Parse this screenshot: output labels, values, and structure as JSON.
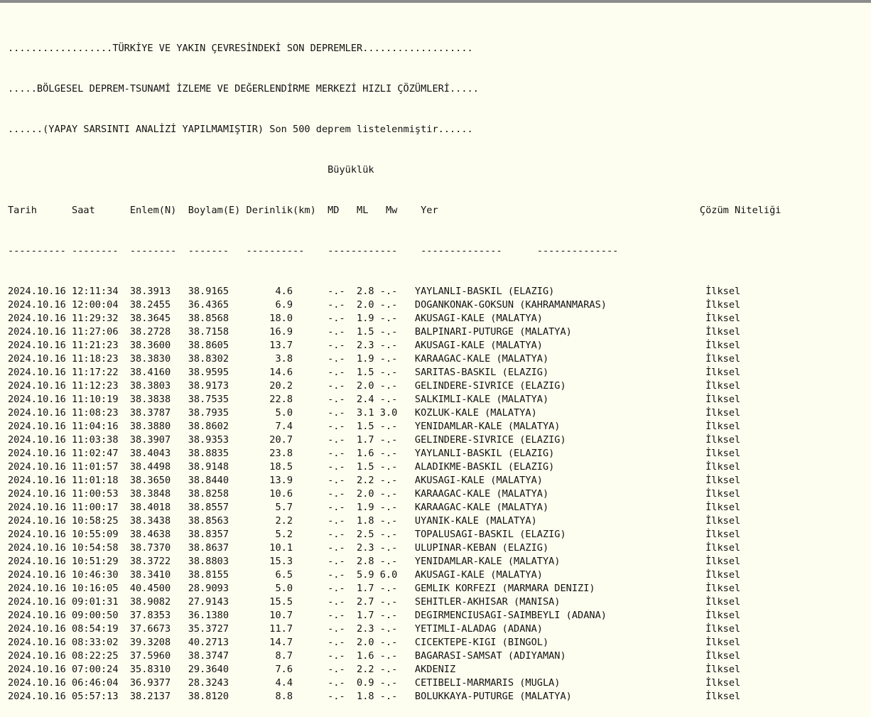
{
  "header": {
    "line1": "..................TÜRKİYE VE YAKIN ÇEVRESİNDEKİ SON DEPREMLER...................",
    "line2": ".....BÖLGESEL DEPREM-TSUNAMİ İZLEME VE DEĞERLENDİRME MERKEZİ HIZLI ÇÖZÜMLERİ.....",
    "line3": "......(YAPAY SARSINTI ANALİZİ YAPILMAMIŞTIR) Son 500 deprem listelenmiştir......"
  },
  "columns": {
    "magnitude_group": "Büyüklük",
    "tarih": "Tarih",
    "saat": "Saat",
    "enlem": "Enlem(N)",
    "boylam": "Boylam(E)",
    "derinlik": "Derinlik(km)",
    "md": "MD",
    "ml": "ML",
    "mw": "Mw",
    "yer": "Yer",
    "cozum": "Çözüm Niteliği"
  },
  "rows": [
    {
      "date": "2024.10.16",
      "time": "12:11:34",
      "lat": "38.3913",
      "lon": "38.9165",
      "depth": "4.6",
      "md": "-.-",
      "ml": "2.8",
      "mw": "-.-",
      "place": "YAYLANLI-BASKIL (ELAZIG)",
      "sol": "İlksel"
    },
    {
      "date": "2024.10.16",
      "time": "12:00:04",
      "lat": "38.2455",
      "lon": "36.4365",
      "depth": "6.9",
      "md": "-.-",
      "ml": "2.0",
      "mw": "-.-",
      "place": "DOGANKONAK-GOKSUN (KAHRAMANMARAS)",
      "sol": "İlksel"
    },
    {
      "date": "2024.10.16",
      "time": "11:29:32",
      "lat": "38.3645",
      "lon": "38.8568",
      "depth": "18.0",
      "md": "-.-",
      "ml": "1.9",
      "mw": "-.-",
      "place": "AKUSAGI-KALE (MALATYA)",
      "sol": "İlksel"
    },
    {
      "date": "2024.10.16",
      "time": "11:27:06",
      "lat": "38.2728",
      "lon": "38.7158",
      "depth": "16.9",
      "md": "-.-",
      "ml": "1.5",
      "mw": "-.-",
      "place": "BALPINARI-PUTURGE (MALATYA)",
      "sol": "İlksel"
    },
    {
      "date": "2024.10.16",
      "time": "11:21:23",
      "lat": "38.3600",
      "lon": "38.8605",
      "depth": "13.7",
      "md": "-.-",
      "ml": "2.3",
      "mw": "-.-",
      "place": "AKUSAGI-KALE (MALATYA)",
      "sol": "İlksel"
    },
    {
      "date": "2024.10.16",
      "time": "11:18:23",
      "lat": "38.3830",
      "lon": "38.8302",
      "depth": "3.8",
      "md": "-.-",
      "ml": "1.9",
      "mw": "-.-",
      "place": "KARAAGAC-KALE (MALATYA)",
      "sol": "İlksel"
    },
    {
      "date": "2024.10.16",
      "time": "11:17:22",
      "lat": "38.4160",
      "lon": "38.9595",
      "depth": "14.6",
      "md": "-.-",
      "ml": "1.5",
      "mw": "-.-",
      "place": "SARITAS-BASKIL (ELAZIG)",
      "sol": "İlksel"
    },
    {
      "date": "2024.10.16",
      "time": "11:12:23",
      "lat": "38.3803",
      "lon": "38.9173",
      "depth": "20.2",
      "md": "-.-",
      "ml": "2.0",
      "mw": "-.-",
      "place": "GELINDERE-SIVRICE (ELAZIG)",
      "sol": "İlksel"
    },
    {
      "date": "2024.10.16",
      "time": "11:10:19",
      "lat": "38.3838",
      "lon": "38.7535",
      "depth": "22.8",
      "md": "-.-",
      "ml": "2.4",
      "mw": "-.-",
      "place": "SALKIMLI-KALE (MALATYA)",
      "sol": "İlksel"
    },
    {
      "date": "2024.10.16",
      "time": "11:08:23",
      "lat": "38.3787",
      "lon": "38.7935",
      "depth": "5.0",
      "md": "-.-",
      "ml": "3.1",
      "mw": "3.0",
      "place": "KOZLUK-KALE (MALATYA)",
      "sol": "İlksel"
    },
    {
      "date": "2024.10.16",
      "time": "11:04:16",
      "lat": "38.3880",
      "lon": "38.8602",
      "depth": "7.4",
      "md": "-.-",
      "ml": "1.5",
      "mw": "-.-",
      "place": "YENIDAMLAR-KALE (MALATYA)",
      "sol": "İlksel"
    },
    {
      "date": "2024.10.16",
      "time": "11:03:38",
      "lat": "38.3907",
      "lon": "38.9353",
      "depth": "20.7",
      "md": "-.-",
      "ml": "1.7",
      "mw": "-.-",
      "place": "GELINDERE-SIVRICE (ELAZIG)",
      "sol": "İlksel"
    },
    {
      "date": "2024.10.16",
      "time": "11:02:47",
      "lat": "38.4043",
      "lon": "38.8835",
      "depth": "23.8",
      "md": "-.-",
      "ml": "1.6",
      "mw": "-.-",
      "place": "YAYLANLI-BASKIL (ELAZIG)",
      "sol": "İlksel"
    },
    {
      "date": "2024.10.16",
      "time": "11:01:57",
      "lat": "38.4498",
      "lon": "38.9148",
      "depth": "18.5",
      "md": "-.-",
      "ml": "1.5",
      "mw": "-.-",
      "place": "ALADIKME-BASKIL (ELAZIG)",
      "sol": "İlksel"
    },
    {
      "date": "2024.10.16",
      "time": "11:01:18",
      "lat": "38.3650",
      "lon": "38.8440",
      "depth": "13.9",
      "md": "-.-",
      "ml": "2.2",
      "mw": "-.-",
      "place": "AKUSAGI-KALE (MALATYA)",
      "sol": "İlksel"
    },
    {
      "date": "2024.10.16",
      "time": "11:00:53",
      "lat": "38.3848",
      "lon": "38.8258",
      "depth": "10.6",
      "md": "-.-",
      "ml": "2.0",
      "mw": "-.-",
      "place": "KARAAGAC-KALE (MALATYA)",
      "sol": "İlksel"
    },
    {
      "date": "2024.10.16",
      "time": "11:00:17",
      "lat": "38.4018",
      "lon": "38.8557",
      "depth": "5.7",
      "md": "-.-",
      "ml": "1.9",
      "mw": "-.-",
      "place": "KARAAGAC-KALE (MALATYA)",
      "sol": "İlksel"
    },
    {
      "date": "2024.10.16",
      "time": "10:58:25",
      "lat": "38.3438",
      "lon": "38.8563",
      "depth": "2.2",
      "md": "-.-",
      "ml": "1.8",
      "mw": "-.-",
      "place": "UYANIK-KALE (MALATYA)",
      "sol": "İlksel"
    },
    {
      "date": "2024.10.16",
      "time": "10:55:09",
      "lat": "38.4638",
      "lon": "38.8357",
      "depth": "5.2",
      "md": "-.-",
      "ml": "2.5",
      "mw": "-.-",
      "place": "TOPALUSAGI-BASKIL (ELAZIG)",
      "sol": "İlksel"
    },
    {
      "date": "2024.10.16",
      "time": "10:54:58",
      "lat": "38.7370",
      "lon": "38.8637",
      "depth": "10.1",
      "md": "-.-",
      "ml": "2.3",
      "mw": "-.-",
      "place": "ULUPINAR-KEBAN (ELAZIG)",
      "sol": "İlksel"
    },
    {
      "date": "2024.10.16",
      "time": "10:51:29",
      "lat": "38.3722",
      "lon": "38.8803",
      "depth": "15.3",
      "md": "-.-",
      "ml": "2.8",
      "mw": "-.-",
      "place": "YENIDAMLAR-KALE (MALATYA)",
      "sol": "İlksel"
    },
    {
      "date": "2024.10.16",
      "time": "10:46:30",
      "lat": "38.3410",
      "lon": "38.8155",
      "depth": "6.5",
      "md": "-.-",
      "ml": "5.9",
      "mw": "6.0",
      "place": "AKUSAGI-KALE (MALATYA)",
      "sol": "İlksel"
    },
    {
      "date": "2024.10.16",
      "time": "10:16:05",
      "lat": "40.4500",
      "lon": "28.9093",
      "depth": "5.0",
      "md": "-.-",
      "ml": "1.7",
      "mw": "-.-",
      "place": "GEMLIK KORFEZI (MARMARA DENIZI)",
      "sol": "İlksel"
    },
    {
      "date": "2024.10.16",
      "time": "09:01:31",
      "lat": "38.9082",
      "lon": "27.9143",
      "depth": "15.5",
      "md": "-.-",
      "ml": "2.7",
      "mw": "-.-",
      "place": "SEHITLER-AKHISAR (MANISA)",
      "sol": "İlksel"
    },
    {
      "date": "2024.10.16",
      "time": "09:00:50",
      "lat": "37.8353",
      "lon": "36.1380",
      "depth": "10.7",
      "md": "-.-",
      "ml": "1.7",
      "mw": "-.-",
      "place": "DEGIRMENCIUSAGI-SAIMBEYLI (ADANA)",
      "sol": "İlksel"
    },
    {
      "date": "2024.10.16",
      "time": "08:54:19",
      "lat": "37.6673",
      "lon": "35.3727",
      "depth": "11.7",
      "md": "-.-",
      "ml": "2.3",
      "mw": "-.-",
      "place": "YETIMLI-ALADAG (ADANA)",
      "sol": "İlksel"
    },
    {
      "date": "2024.10.16",
      "time": "08:33:02",
      "lat": "39.3208",
      "lon": "40.2713",
      "depth": "14.7",
      "md": "-.-",
      "ml": "2.0",
      "mw": "-.-",
      "place": "CICEKTEPE-KIGI (BINGOL)",
      "sol": "İlksel"
    },
    {
      "date": "2024.10.16",
      "time": "08:22:25",
      "lat": "37.5960",
      "lon": "38.3747",
      "depth": "8.7",
      "md": "-.-",
      "ml": "1.6",
      "mw": "-.-",
      "place": "BAGARASI-SAMSAT (ADIYAMAN)",
      "sol": "İlksel"
    },
    {
      "date": "2024.10.16",
      "time": "07:00:24",
      "lat": "35.8310",
      "lon": "29.3640",
      "depth": "7.6",
      "md": "-.-",
      "ml": "2.2",
      "mw": "-.-",
      "place": "AKDENIZ",
      "sol": "İlksel"
    },
    {
      "date": "2024.10.16",
      "time": "06:46:04",
      "lat": "36.9377",
      "lon": "28.3243",
      "depth": "4.4",
      "md": "-.-",
      "ml": "0.9",
      "mw": "-.-",
      "place": "CETIBELI-MARMARIS (MUGLA)",
      "sol": "İlksel"
    },
    {
      "date": "2024.10.16",
      "time": "05:57:13",
      "lat": "38.2137",
      "lon": "38.8120",
      "depth": "8.8",
      "md": "-.-",
      "ml": "1.8",
      "mw": "-.-",
      "place": "BOLUKKAYA-PUTURGE (MALATYA)",
      "sol": "İlksel"
    }
  ]
}
